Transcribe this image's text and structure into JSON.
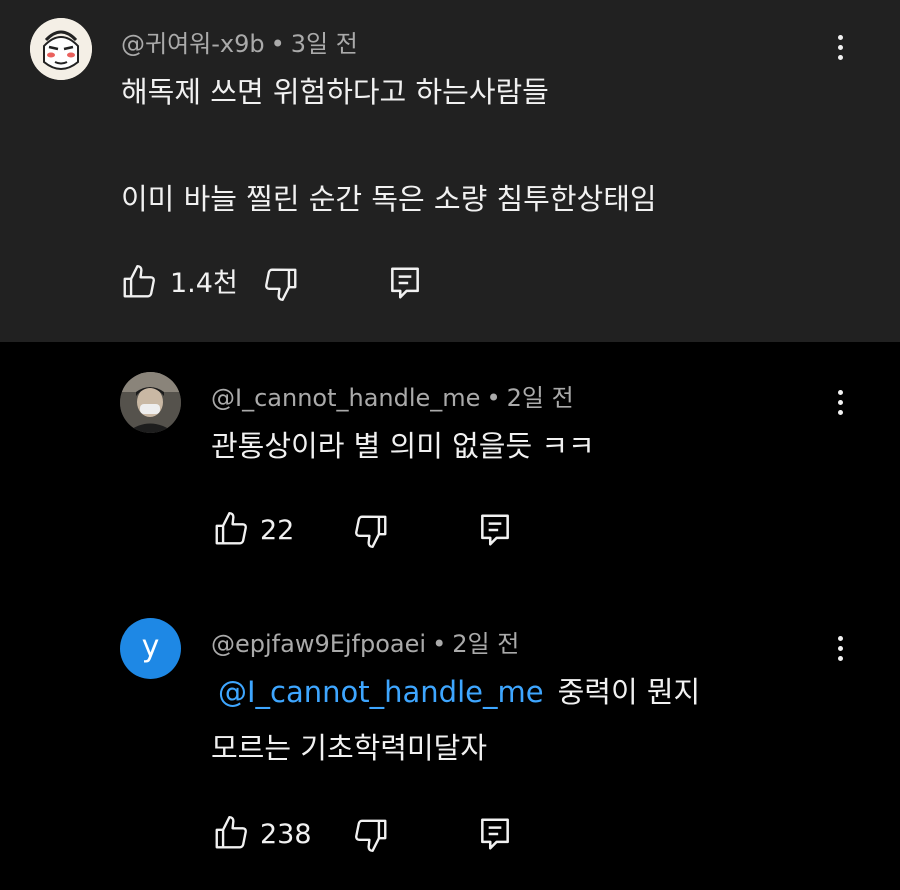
{
  "comments": [
    {
      "handle": "@귀여워-x9b",
      "time": "3일 전",
      "lines": [
        "해독제 쓰면 위험하다고 하는사람들",
        "이미 바늘 찔린 순간 독은 소량 침투한상태임"
      ],
      "likes": "1.4천",
      "avatar_bg": "#f4efe6"
    },
    {
      "handle": "@I_cannot_handle_me",
      "time": "2일 전",
      "lines": [
        "관통상이라 별 의미 없을듯 ㅋㅋ"
      ],
      "likes": "22",
      "avatar_bg": "#3a3a3a"
    },
    {
      "handle": "@epjfaw9Ejfpoaei",
      "time": "2일 전",
      "mention": "@I_cannot_handle_me",
      "lines": [
        "중력이 뭔지",
        "모르는 기초학력미달자"
      ],
      "likes": "238",
      "avatar_letter": "y",
      "avatar_bg": "#1e88e5"
    }
  ],
  "colors": {
    "text": "#f1f1f1",
    "meta": "#aaaaaa",
    "mention": "#3ea6ff",
    "highlight_bg": "#212121"
  }
}
